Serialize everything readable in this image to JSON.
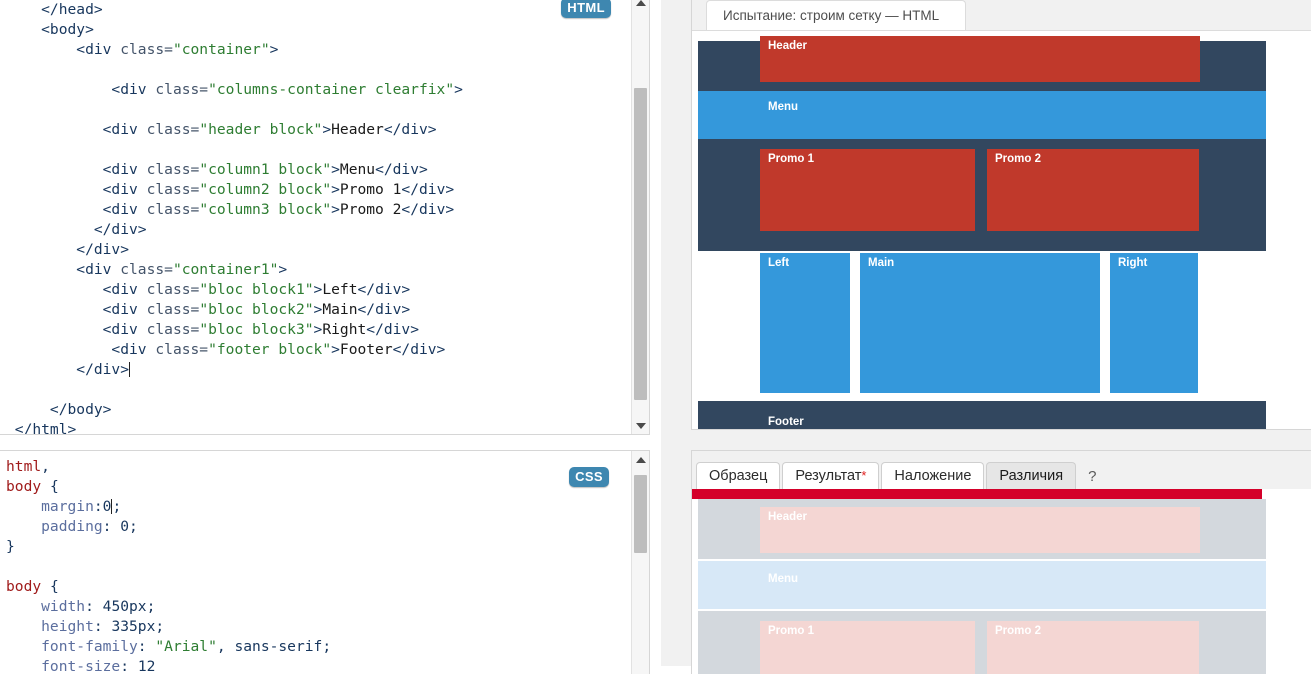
{
  "html_editor": {
    "badge": "HTML",
    "lines": [
      [
        {
          "t": "tag",
          "s": "    </head>"
        }
      ],
      [
        {
          "t": "tag",
          "s": "    <body>"
        }
      ],
      [
        {
          "t": "tag",
          "s": "        <div "
        },
        {
          "t": "attr",
          "s": "class="
        },
        {
          "t": "str",
          "s": "\"container\""
        },
        {
          "t": "tag",
          "s": ">"
        }
      ],
      [
        {
          "t": "plain",
          "s": ""
        }
      ],
      [
        {
          "t": "tag",
          "s": "            <div "
        },
        {
          "t": "attr",
          "s": "class="
        },
        {
          "t": "str",
          "s": "\"columns-container clearfix\""
        },
        {
          "t": "tag",
          "s": ">"
        }
      ],
      [
        {
          "t": "plain",
          "s": ""
        }
      ],
      [
        {
          "t": "tag",
          "s": "           <div "
        },
        {
          "t": "attr",
          "s": "class="
        },
        {
          "t": "str",
          "s": "\"header block\""
        },
        {
          "t": "tag",
          "s": ">"
        },
        {
          "t": "text",
          "s": "Header"
        },
        {
          "t": "tag",
          "s": "</div>"
        }
      ],
      [
        {
          "t": "plain",
          "s": ""
        }
      ],
      [
        {
          "t": "tag",
          "s": "           <div "
        },
        {
          "t": "attr",
          "s": "class="
        },
        {
          "t": "str",
          "s": "\"column1 block\""
        },
        {
          "t": "tag",
          "s": ">"
        },
        {
          "t": "text",
          "s": "Menu"
        },
        {
          "t": "tag",
          "s": "</div>"
        }
      ],
      [
        {
          "t": "tag",
          "s": "           <div "
        },
        {
          "t": "attr",
          "s": "class="
        },
        {
          "t": "str",
          "s": "\"column2 block\""
        },
        {
          "t": "tag",
          "s": ">"
        },
        {
          "t": "text",
          "s": "Promo 1"
        },
        {
          "t": "tag",
          "s": "</div>"
        }
      ],
      [
        {
          "t": "tag",
          "s": "           <div "
        },
        {
          "t": "attr",
          "s": "class="
        },
        {
          "t": "str",
          "s": "\"column3 block\""
        },
        {
          "t": "tag",
          "s": ">"
        },
        {
          "t": "text",
          "s": "Promo 2"
        },
        {
          "t": "tag",
          "s": "</div>"
        }
      ],
      [
        {
          "t": "tag",
          "s": "          </div>"
        }
      ],
      [
        {
          "t": "tag",
          "s": "        </div>"
        }
      ],
      [
        {
          "t": "tag",
          "s": "        <div "
        },
        {
          "t": "attr",
          "s": "class="
        },
        {
          "t": "str",
          "s": "\"container1\""
        },
        {
          "t": "tag",
          "s": ">"
        }
      ],
      [
        {
          "t": "tag",
          "s": "           <div "
        },
        {
          "t": "attr",
          "s": "class="
        },
        {
          "t": "str",
          "s": "\"bloc block1\""
        },
        {
          "t": "tag",
          "s": ">"
        },
        {
          "t": "text",
          "s": "Left"
        },
        {
          "t": "tag",
          "s": "</div>"
        }
      ],
      [
        {
          "t": "tag",
          "s": "           <div "
        },
        {
          "t": "attr",
          "s": "class="
        },
        {
          "t": "str",
          "s": "\"bloc block2\""
        },
        {
          "t": "tag",
          "s": ">"
        },
        {
          "t": "text",
          "s": "Main"
        },
        {
          "t": "tag",
          "s": "</div>"
        }
      ],
      [
        {
          "t": "tag",
          "s": "           <div "
        },
        {
          "t": "attr",
          "s": "class="
        },
        {
          "t": "str",
          "s": "\"bloc block3\""
        },
        {
          "t": "tag",
          "s": ">"
        },
        {
          "t": "text",
          "s": "Right"
        },
        {
          "t": "tag",
          "s": "</div>"
        }
      ],
      [
        {
          "t": "tag",
          "s": "            <div "
        },
        {
          "t": "attr",
          "s": "class="
        },
        {
          "t": "str",
          "s": "\"footer block\""
        },
        {
          "t": "tag",
          "s": ">"
        },
        {
          "t": "text",
          "s": "Footer"
        },
        {
          "t": "tag",
          "s": "</div>"
        }
      ],
      [
        {
          "t": "tag",
          "s": "        </div>"
        },
        {
          "t": "caret",
          "s": ""
        }
      ],
      [
        {
          "t": "plain",
          "s": ""
        }
      ],
      [
        {
          "t": "tag",
          "s": "     </body>"
        }
      ],
      [
        {
          "t": "tag",
          "s": " </html>"
        }
      ]
    ]
  },
  "css_editor": {
    "badge": "CSS",
    "lines": [
      [
        {
          "t": "sel",
          "s": "html"
        },
        {
          "t": "punct",
          "s": ","
        }
      ],
      [
        {
          "t": "sel",
          "s": "body"
        },
        {
          "t": "punct",
          "s": " {"
        }
      ],
      [
        {
          "t": "prop",
          "s": "    margin"
        },
        {
          "t": "punct",
          "s": ":"
        },
        {
          "t": "num",
          "s": "0"
        },
        {
          "t": "caret",
          "s": ""
        },
        {
          "t": "punct",
          "s": ";"
        }
      ],
      [
        {
          "t": "prop",
          "s": "    padding"
        },
        {
          "t": "punct",
          "s": ": "
        },
        {
          "t": "num",
          "s": "0"
        },
        {
          "t": "punct",
          "s": ";"
        }
      ],
      [
        {
          "t": "punct",
          "s": "}"
        }
      ],
      [
        {
          "t": "plain",
          "s": ""
        }
      ],
      [
        {
          "t": "sel",
          "s": "body"
        },
        {
          "t": "punct",
          "s": " {"
        }
      ],
      [
        {
          "t": "prop",
          "s": "    width"
        },
        {
          "t": "punct",
          "s": ": "
        },
        {
          "t": "num",
          "s": "450px"
        },
        {
          "t": "punct",
          "s": ";"
        }
      ],
      [
        {
          "t": "prop",
          "s": "    height"
        },
        {
          "t": "punct",
          "s": ": "
        },
        {
          "t": "num",
          "s": "335px"
        },
        {
          "t": "punct",
          "s": ";"
        }
      ],
      [
        {
          "t": "prop",
          "s": "    font-family"
        },
        {
          "t": "punct",
          "s": ": "
        },
        {
          "t": "str",
          "s": "\"Arial\""
        },
        {
          "t": "val",
          "s": ", sans-serif"
        },
        {
          "t": "punct",
          "s": ";"
        }
      ],
      [
        {
          "t": "prop",
          "s": "    font-size"
        },
        {
          "t": "punct",
          "s": ": "
        },
        {
          "t": "num",
          "s": "12"
        }
      ]
    ]
  },
  "preview": {
    "tab_title": "Испытание: строим сетку — HTML",
    "blocks": [
      {
        "label": "Header",
        "kind": "red"
      },
      {
        "label": "Menu",
        "kind": "blue-band"
      },
      {
        "label": "Promo 1",
        "kind": "red"
      },
      {
        "label": "Promo 2",
        "kind": "red"
      },
      {
        "label": "Left",
        "kind": "blue"
      },
      {
        "label": "Main",
        "kind": "blue"
      },
      {
        "label": "Right",
        "kind": "blue"
      },
      {
        "label": "Footer",
        "kind": "dark"
      }
    ]
  },
  "compare": {
    "tabs": [
      {
        "label": "Образец",
        "active": false,
        "modified": false
      },
      {
        "label": "Результат",
        "active": false,
        "modified": true
      },
      {
        "label": "Наложение",
        "active": false,
        "modified": false
      },
      {
        "label": "Различия",
        "active": true,
        "modified": false
      }
    ],
    "help_label": "?",
    "diff_blocks": [
      {
        "label": "Header"
      },
      {
        "label": "Menu"
      },
      {
        "label": "Promo 1"
      },
      {
        "label": "Promo 2"
      }
    ]
  },
  "colors": {
    "red_block": "#c0392b",
    "blue_block": "#3498db",
    "dark_band": "#32475f",
    "badge_blue": "#3e87b0",
    "diff_bar": "#d4002a",
    "modified_star": "#e02020"
  }
}
